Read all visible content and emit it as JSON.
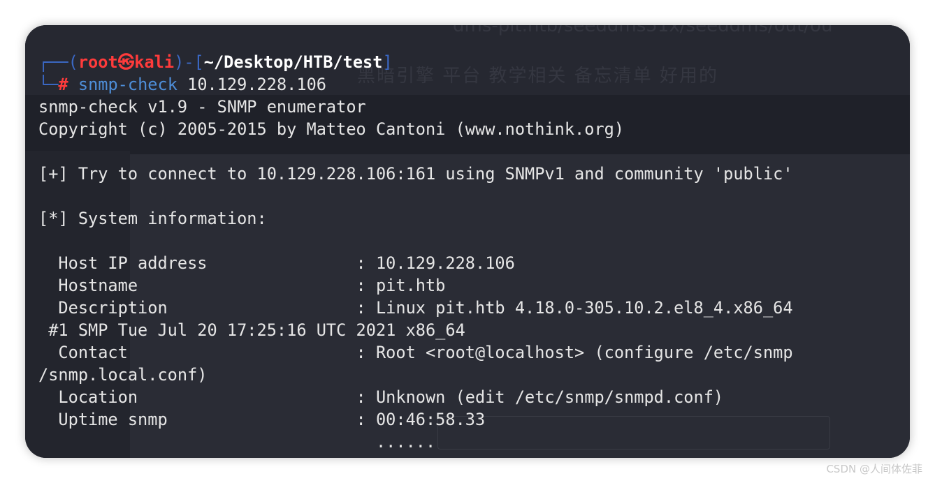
{
  "terminal": {
    "prompt": {
      "tl_corner": "┌──",
      "open_paren": "(",
      "user": "root",
      "skull": "㉿",
      "host": "kali",
      "close_paren": ")",
      "dash": "-",
      "open_bracket": "[",
      "path": "~/Desktop/HTB/test",
      "close_bracket": "]",
      "bl_corner": "└─",
      "hash": "#",
      "command": "snmp-check",
      "args": " 10.129.228.106"
    },
    "output": [
      "snmp-check v1.9 - SNMP enumerator",
      "Copyright (c) 2005-2015 by Matteo Cantoni (www.nothink.org)",
      "",
      "[+] Try to connect to 10.129.228.106:161 using SNMPv1 and community 'public'",
      "",
      "[*] System information:",
      "",
      "  Host IP address               : 10.129.228.106",
      "  Hostname                      : pit.htb",
      "  Description                   : Linux pit.htb 4.18.0-305.10.2.el8_4.x86_64",
      " #1 SMP Tue Jul 20 17:25:16 UTC 2021 x86_64",
      "  Contact                       : Root <root@localhost> (configure /etc/snmp",
      "/snmp.local.conf)",
      "  Location                      : Unknown (edit /etc/snmp/snmpd.conf)",
      "  Uptime snmp                   : 00:46:58.33",
      "                                  ......"
    ]
  },
  "background": {
    "url_text": "dms-pit.htb/seeddms51x/seeddms/out/ou",
    "bookmarks": "黑暗引擎   平台   教学相关   备忘清单   好用的"
  },
  "watermark": "CSDN @人间体佐菲",
  "colors": {
    "terminal_bg": "#1f2129",
    "prompt_bracket": "#3b68c4",
    "prompt_user": "#ff3b3b",
    "command": "#4e8ed8",
    "text": "#e6e6e6"
  }
}
